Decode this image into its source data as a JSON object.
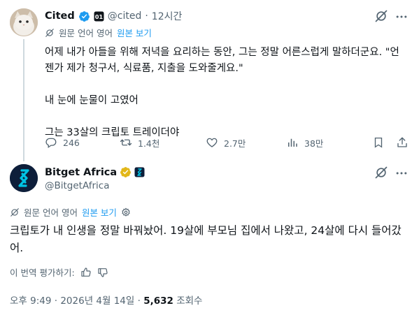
{
  "quoted_tweet": {
    "author_name": "Cited",
    "handle": "@cited",
    "time_ago": "12시간",
    "translation_label": "원문 언어 영어",
    "show_original": "원본 보기",
    "text_line1": "어제 내가 아들을 위해 저녁을 요리하는 동안, 그는 정말 어른스럽게 말하더군요. \"언젠가 제가 청구서, 식료품, 지출을 도와줄게요.\"",
    "text_line2": "내 눈에 눈물이 고였어",
    "text_line3": "그는 33살의 크립토 트레이더야",
    "replies": "246",
    "reposts": "1.4천",
    "likes": "2.7만",
    "views": "38만"
  },
  "main_tweet": {
    "author_name": "Bitget Africa",
    "handle": "@BitgetAfrica",
    "translation_label": "원문 언어 영어",
    "show_original": "원본 보기",
    "text": "크립토가 내 인생을 정말 바꿔놨어. 19살에 부모님 집에서 나왔고, 24살에 다시 들어갔어.",
    "rate_translation": "이 번역 평가하기:",
    "time": "오후 9:49",
    "date": "2026년 4월 14일",
    "views_count": "5,632",
    "views_label": "조회수"
  },
  "colors": {
    "accent": "#1d9bf0",
    "muted": "#536471",
    "gold": "#e2b719",
    "bitget": "#00c3e3"
  },
  "icons": [
    "verified-badge-icon",
    "affiliate-badge-icon",
    "grok-icon",
    "more-icon",
    "translate-icon",
    "reply-icon",
    "repost-icon",
    "like-icon",
    "views-icon",
    "bookmark-icon",
    "share-icon",
    "settings-icon",
    "thumbs-up-icon",
    "thumbs-down-icon"
  ]
}
